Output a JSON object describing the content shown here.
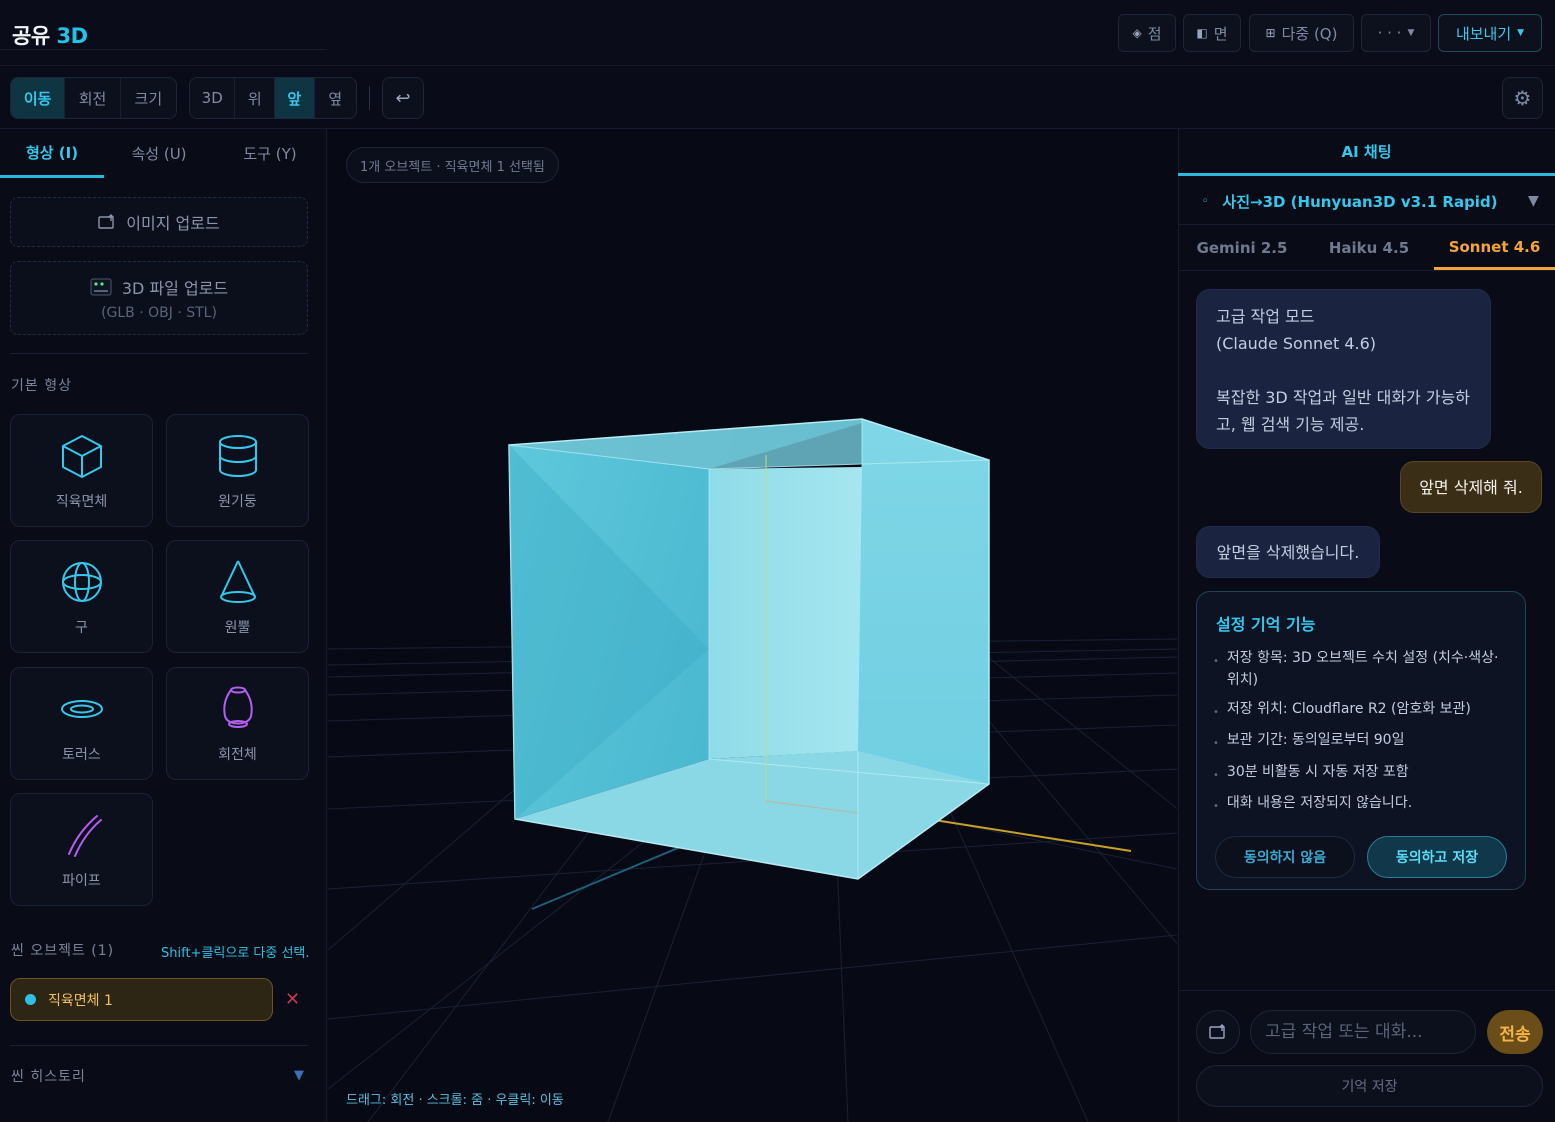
{
  "app": {
    "title_main": "공유",
    "title_accent": "3D"
  },
  "header": {
    "buttons": [
      {
        "icon": "◈",
        "label": "점"
      },
      {
        "icon": "◧",
        "label": "면"
      },
      {
        "icon": "⊞",
        "label": "다중 (Q)"
      },
      {
        "icon": "",
        "label": "· · ·"
      },
      {
        "icon": "",
        "label": "내보내기"
      }
    ]
  },
  "toolbar": {
    "transform_modes": [
      "이동",
      "회전",
      "크기"
    ],
    "active_transform": "이동",
    "view_modes": [
      "3D",
      "위",
      "앞",
      "옆"
    ],
    "active_view": "앞",
    "undo_icon": "↩",
    "settings_icon": "⚙"
  },
  "left_panel": {
    "tabs": [
      "형상 (I)",
      "속성 (U)",
      "도구 (Y)"
    ],
    "active_tab": "형상 (I)",
    "image_upload": "이미지 업로드",
    "file_upload": "3D 파일 업로드",
    "file_upload_formats": "(GLB · OBJ · STL)",
    "basic_shapes_title": "기본 형상",
    "shapes": [
      "직육면체",
      "원기둥",
      "구",
      "원뿔",
      "토러스",
      "회전체",
      "파이프"
    ],
    "scene_objects_title": "씬 오브젝트 (1)",
    "multi_select_hint": "Shift+클릭으로 다중 선택.",
    "objects": [
      {
        "name": "직육면체 1"
      }
    ],
    "delete_icon": "✕",
    "scene_history_title": "씬 히스토리",
    "history_caret": "▼"
  },
  "viewport": {
    "status": "1개 오브젝트 · 직육면체 1 선택됨",
    "controls_hint": "드래그: 회전 · 스크롤: 줌 · 우클릭: 이동"
  },
  "right_panel": {
    "title": "AI 채팅",
    "model_select": "사진→3D (Hunyuan3D v3.1 Rapid)",
    "model_select_caret": "▼",
    "model_tabs": [
      "Gemini 2.5",
      "Haiku 4.5",
      "Sonnet 4.6"
    ],
    "active_model": "Sonnet 4.6",
    "messages": [
      {
        "role": "bot",
        "lines": [
          "고급 작업 모드",
          "(Claude Sonnet 4.6)",
          "",
          "복잡한 3D 작업과 일반 대화가 가능하",
          "고, 웹 검색 기능 제공."
        ]
      },
      {
        "role": "user",
        "text": "앞면 삭제해 줘."
      },
      {
        "role": "bot",
        "text": "앞면을 삭제했습니다."
      }
    ],
    "memory_card": {
      "title": "설정 기억 기능",
      "items": [
        "저장 항목: 3D 오브젝트 수치 설정 (치수·색상·위치)",
        "저장 위치: Cloudflare R2 (암호화 보관)",
        "보관 기간: 동의일로부터 90일",
        "30분 비활동 시 자동 저장 포함",
        "대화 내용은 저장되지 않습니다."
      ],
      "decline": "동의하지 않음",
      "agree": "동의하고 저장"
    },
    "input_placeholder": "고급 작업 또는 대화...",
    "send": "전송",
    "save_memory": "기억 저장"
  },
  "colors": {
    "accent": "#22c3e6",
    "selection": "#f1c064",
    "user_bubble": "#3b2e17",
    "bot_bubble": "#1a2340",
    "cube": "#5ccbe0"
  }
}
